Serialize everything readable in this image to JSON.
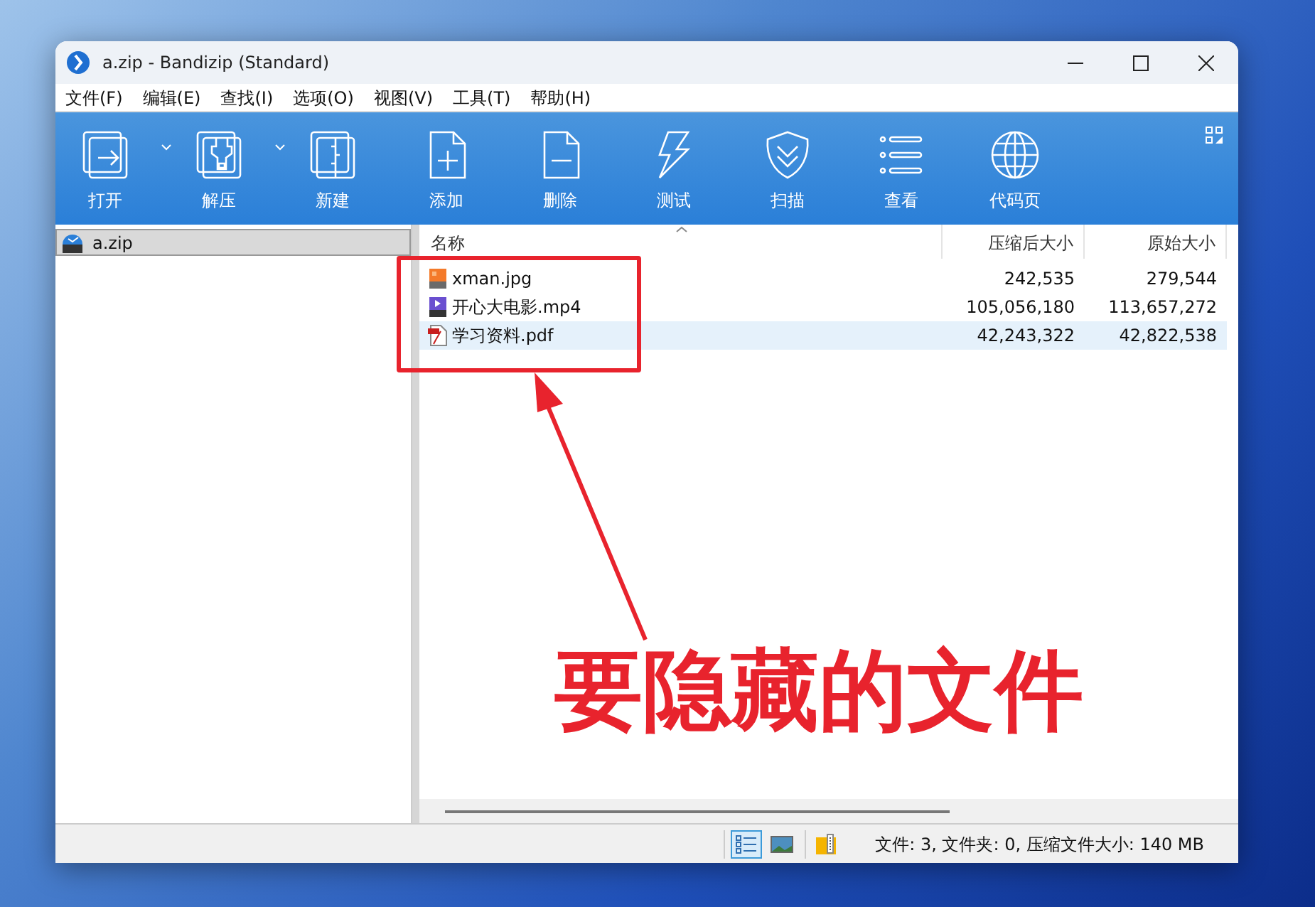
{
  "window": {
    "title": "a.zip - Bandizip (Standard)"
  },
  "menu": [
    "文件(F)",
    "编辑(E)",
    "查找(I)",
    "选项(O)",
    "视图(V)",
    "工具(T)",
    "帮助(H)"
  ],
  "toolbar": [
    {
      "label": "打开",
      "kind": "open",
      "dropdown": true
    },
    {
      "label": "解压",
      "kind": "extract",
      "dropdown": true
    },
    {
      "label": "新建",
      "kind": "new",
      "dropdown": false
    },
    {
      "label": "添加",
      "kind": "add",
      "dropdown": false
    },
    {
      "label": "删除",
      "kind": "delete",
      "dropdown": false
    },
    {
      "label": "测试",
      "kind": "test",
      "dropdown": false
    },
    {
      "label": "扫描",
      "kind": "scan",
      "dropdown": false
    },
    {
      "label": "查看",
      "kind": "view",
      "dropdown": false
    },
    {
      "label": "代码页",
      "kind": "codepage",
      "dropdown": false
    }
  ],
  "tree": [
    {
      "label": "a.zip",
      "selected": true
    }
  ],
  "table": {
    "columns": [
      "名称",
      "压缩后大小",
      "原始大小"
    ],
    "rows": [
      {
        "name": "xman.jpg",
        "kind": "jpg",
        "compressed": "242,535",
        "original": "279,544",
        "selected": false
      },
      {
        "name": "开心大电影.mp4",
        "kind": "mp4",
        "compressed": "105,056,180",
        "original": "113,657,272",
        "selected": false
      },
      {
        "name": "学习资料.pdf",
        "kind": "pdf",
        "compressed": "42,243,322",
        "original": "42,822,538",
        "selected": true
      }
    ]
  },
  "status_bar": {
    "views": [
      {
        "kind": "details",
        "selected": true
      },
      {
        "kind": "thumbnails",
        "selected": false
      }
    ],
    "text": "文件: 3, 文件夹: 0, 压缩文件大小: 140 MB"
  },
  "annotation": {
    "text": "要隐藏的文件"
  }
}
